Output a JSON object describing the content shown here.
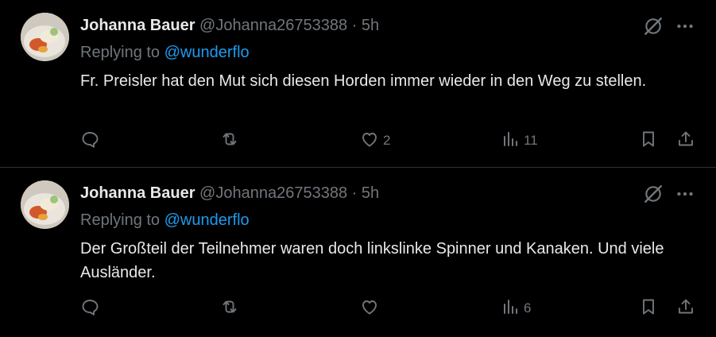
{
  "tweets": [
    {
      "name": "Johanna Bauer",
      "handle": "@Johanna26753388",
      "separator": "·",
      "time": "5h",
      "replying_prefix": "Replying to",
      "replying_to": "@wunderflo",
      "text": "Fr. Preisler hat den Mut sich diesen Horden immer wieder in den Weg zu stellen.",
      "likes": "2",
      "views": "11"
    },
    {
      "name": "Johanna Bauer",
      "handle": "@Johanna26753388",
      "separator": "·",
      "time": "5h",
      "replying_prefix": "Replying to",
      "replying_to": "@wunderflo",
      "text": "Der Großteil der Teilnehmer waren doch linkslinke Spinner und Kanaken. Und viele Ausländer.",
      "likes": "",
      "views": "6"
    }
  ],
  "colors": {
    "background": "#000000",
    "text": "#e7e9ea",
    "secondary": "#71767b",
    "link": "#1d9bf0",
    "divider": "#2f3336"
  },
  "icons": [
    "grok-icon",
    "more-icon",
    "reply-icon",
    "retweet-icon",
    "like-icon",
    "views-icon",
    "bookmark-icon",
    "share-icon"
  ]
}
